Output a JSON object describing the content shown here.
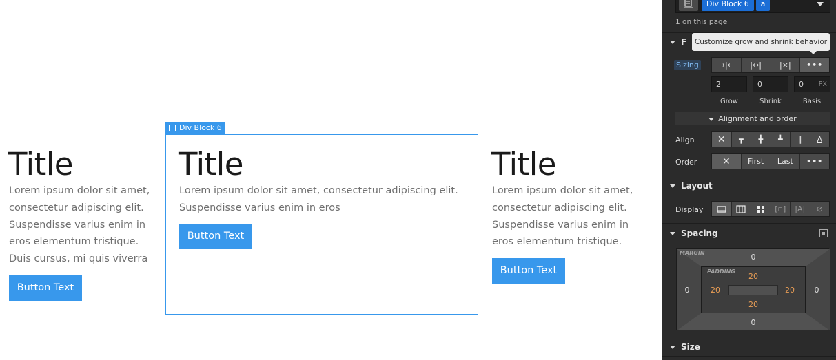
{
  "canvas": {
    "columns": [
      {
        "title": "Title",
        "body": "Lorem ipsum dolor sit amet, consectetur adipiscing elit. Suspendisse varius enim in eros elementum tristique. Duis cursus, mi quis viverra",
        "button": "Button Text"
      },
      {
        "title": "Title",
        "body": "Lorem ipsum dolor sit amet, consectetur adipiscing elit. Suspendisse varius enim in eros",
        "button": "Button Text"
      },
      {
        "title": "Title",
        "body": "Lorem ipsum dolor sit amet, consectetur adipiscing elit. Suspendisse varius enim in eros elementum tristique.",
        "button": "Button Text"
      }
    ],
    "selection_label": "Div Block 6"
  },
  "panel": {
    "selector": {
      "chip": "Div Block 6",
      "chip2": "a"
    },
    "on_page": "1 on this page",
    "tooltip": "Customize grow and shrink behavior",
    "flex_child_head": "F",
    "sizing": {
      "label": "Sizing",
      "grow": "2",
      "shrink": "0",
      "basis": "0",
      "unit": "PX",
      "grow_label": "Grow",
      "shrink_label": "Shrink",
      "basis_label": "Basis"
    },
    "alignment_head": "Alignment and order",
    "align_label": "Align",
    "order": {
      "label": "Order",
      "first": "First",
      "last": "Last"
    },
    "layout": {
      "head": "Layout",
      "display_label": "Display"
    },
    "spacing": {
      "head": "Spacing",
      "margin_label": "MARGIN",
      "padding_label": "PADDING",
      "margin": {
        "top": "0",
        "right": "0",
        "bottom": "0",
        "left": "0"
      },
      "padding": {
        "top": "20",
        "right": "20",
        "bottom": "20",
        "left": "20"
      }
    },
    "size_head": "Size",
    "colors": {
      "accent": "#3898ec",
      "panel": "#2b2b2b",
      "padding_value": "#e89d55"
    }
  }
}
